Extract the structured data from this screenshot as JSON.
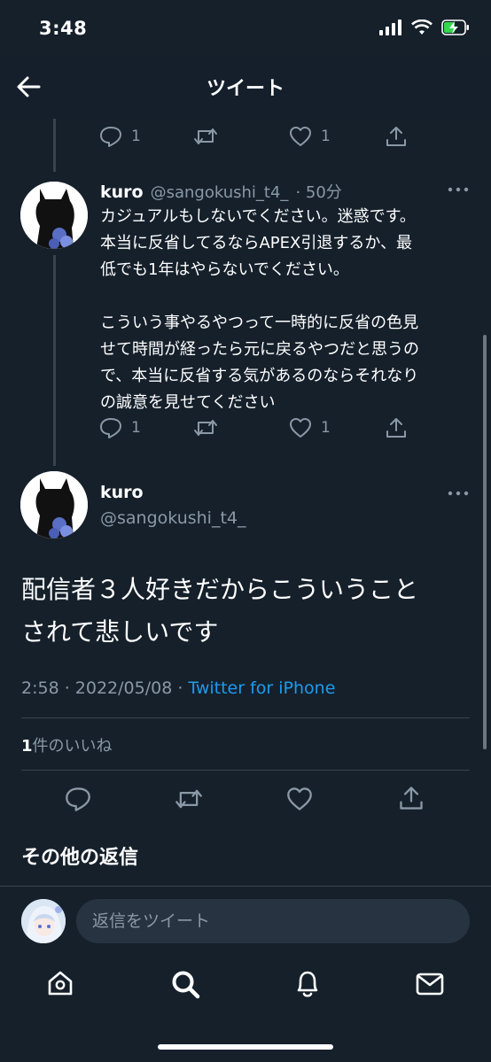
{
  "status_bar": {
    "time": "3:48"
  },
  "header": {
    "title": "ツイート"
  },
  "prev_tweet_actions": {
    "reply_count": "1",
    "like_count": "1"
  },
  "reply_tweet": {
    "name": "kuro",
    "handle": "@sangokushi_t4_",
    "time": "· 50分",
    "text": "カジュアルもしないでください。迷惑です。\n本当に反省してるならAPEX引退するか、最\n低でも1年はやらないでください。\n\nこういう事やるやつって一時的に反省の色見\nせて時間が経ったら元に戻るやつだと思うの\nで、本当に反省する気があるのならそれなり\nの誠意を見せてください",
    "reply_count": "1",
    "like_count": "1"
  },
  "main_tweet": {
    "name": "kuro",
    "handle": "@sangokushi_t4_",
    "text": "配信者３人好きだからこういうこと\nされて悲しいです",
    "timestamp": "2:58 · 2022/05/08 ·",
    "source": "Twitter for iPhone",
    "likes_count": "1",
    "likes_label": "件のいいね"
  },
  "more_replies": {
    "title": "その他の返信"
  },
  "reply_box": {
    "placeholder": "返信をツイート"
  },
  "icons": {
    "back": "back-arrow-icon",
    "reply": "reply-icon",
    "retweet": "retweet-icon",
    "like": "heart-icon",
    "share": "share-icon",
    "more": "more-icon",
    "nav": [
      "home-icon",
      "search-icon",
      "notifications-icon",
      "messages-icon"
    ]
  },
  "colors": {
    "background": "#15202b",
    "link": "#1d9bf0",
    "muted": "#8b98a5"
  }
}
